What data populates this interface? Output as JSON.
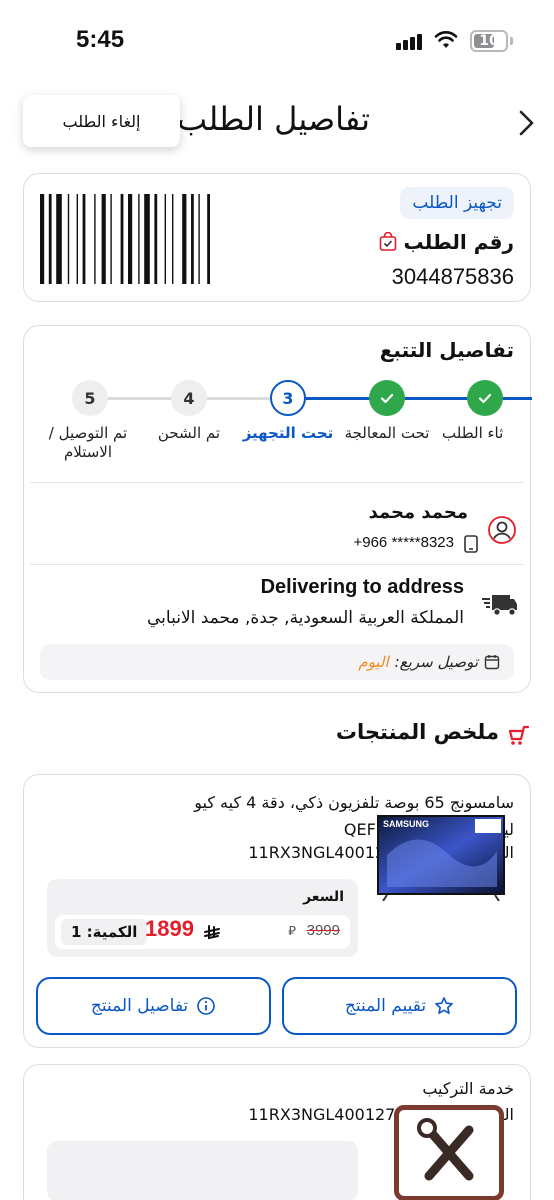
{
  "status_bar": {
    "time": "5:45",
    "battery": "10"
  },
  "header": {
    "title": "تفاصيل الطلب",
    "cancel_label": "إلغاء الطلب"
  },
  "order": {
    "status_chip": "تجهيز الطلب",
    "number_label": "رقم الطلب",
    "number": "3044875836"
  },
  "tracking": {
    "title": "تفاصيل التتبع",
    "steps": [
      {
        "label": "ثاء الطلب",
        "state": "done"
      },
      {
        "label": "تحت المعالجة",
        "state": "done"
      },
      {
        "number": "3",
        "label": "تحت التجهيز",
        "state": "current"
      },
      {
        "number": "4",
        "label": "تم الشحن",
        "state": "pending"
      },
      {
        "number": "5",
        "label": "تم التوصيل / الاستلام",
        "state": "pending"
      }
    ]
  },
  "contact": {
    "name": "محمد محمد",
    "phone": "+966 *****8323"
  },
  "delivery": {
    "title": "Delivering to address",
    "address": "المملكة العربية السعودية, جدة, محمد الانبابي",
    "fast_label": "توصيل سريع:",
    "fast_value": "اليوم"
  },
  "summary": {
    "title": "ملخص المنتجات"
  },
  "product": {
    "name": "سامسونج 65 بوصة تلفزيون ذكي، دقة 4 كيه كيو ليد، 50 Hz، اسود، QEF1",
    "serial": "الرقم التسلسلي: 11RX3NGL400127",
    "price_label": "السعر",
    "price_now": "1899",
    "price_old": "3999",
    "quantity": "الكمية: 1",
    "rate_label": "تقييم المنتج",
    "details_label": "تفاصيل المنتج",
    "image_brand": "SAMSUNG"
  },
  "service": {
    "name": "خدمة التركيب",
    "serial": "الرقم التسلسلي: 11RX3NGL400127"
  },
  "colors": {
    "accent": "#0a57c6",
    "success": "#2ea84a",
    "price": "#e41e2b",
    "fast": "#f08a1c"
  }
}
